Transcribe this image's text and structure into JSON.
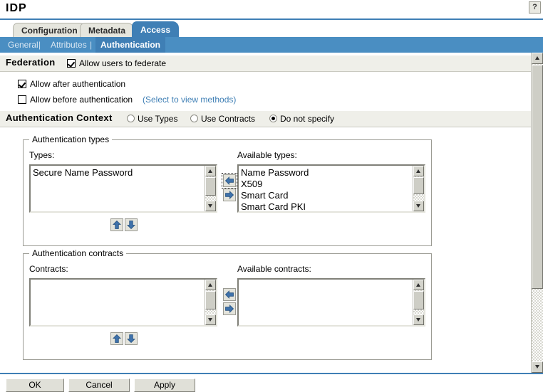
{
  "window": {
    "title": "IDP",
    "help_label": "?"
  },
  "tabs": [
    {
      "label": "Configuration",
      "active": false
    },
    {
      "label": "Metadata",
      "active": false
    },
    {
      "label": "Access",
      "active": true
    }
  ],
  "subtabs": [
    {
      "label": "General",
      "active": false
    },
    {
      "label": "Attributes",
      "active": false
    },
    {
      "label": "Authentication",
      "active": true
    }
  ],
  "subtab_separator": "|",
  "federation": {
    "section_title": "Federation",
    "allow_federate_label": "Allow users to federate",
    "allow_federate_checked": true,
    "allow_after_label": "Allow after authentication",
    "allow_after_checked": true,
    "allow_before_label": "Allow before authentication",
    "allow_before_checked": false,
    "select_methods_hint": "(Select to view methods)"
  },
  "auth_context": {
    "section_title": "Authentication Context",
    "options": [
      {
        "label": "Use Types",
        "selected": false
      },
      {
        "label": "Use Contracts",
        "selected": false
      },
      {
        "label": "Do not specify",
        "selected": true
      }
    ]
  },
  "auth_types": {
    "legend": "Authentication types",
    "selected_label": "Types:",
    "available_label": "Available types:",
    "selected_items": [
      "Secure Name Password"
    ],
    "available_items": [
      "Name Password",
      "X509",
      "Smart Card",
      "Smart Card PKI"
    ],
    "move_left_icon": "arrow-left-icon",
    "move_right_icon": "arrow-right-icon",
    "move_up_icon": "arrow-up-icon",
    "move_down_icon": "arrow-down-icon"
  },
  "auth_contracts": {
    "legend": "Authentication contracts",
    "selected_label": "Contracts:",
    "available_label": "Available contracts:",
    "selected_items": [],
    "available_items": [],
    "move_left_icon": "arrow-left-icon",
    "move_right_icon": "arrow-right-icon",
    "move_up_icon": "arrow-up-icon",
    "move_down_icon": "arrow-down-icon"
  },
  "footer": {
    "ok_label": "OK",
    "cancel_label": "Cancel",
    "apply_label": "Apply"
  },
  "colors": {
    "accent_blue": "#3f7fb5",
    "subtab_blue": "#4a8ec2",
    "link_blue": "#3f7fb5",
    "panel_gray": "#efefe9",
    "arrow_blue": "#3f72ab"
  }
}
